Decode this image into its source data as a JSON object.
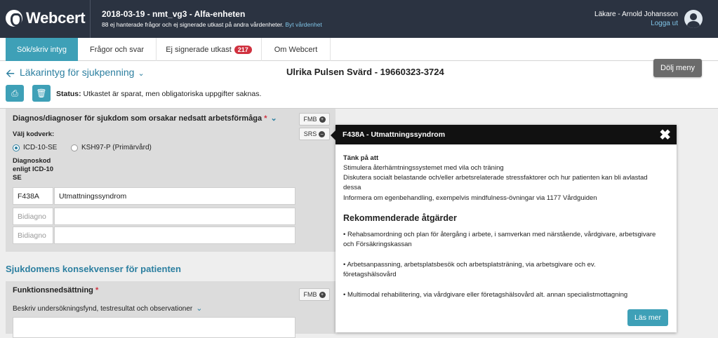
{
  "header": {
    "logo_text": "Webcert",
    "unit_title": "2018-03-19 - nmt_vg3 - Alfa-enheten",
    "unit_sub": "88 ej hanterade frågor och ej signerade utkast på andra vårdenheter.",
    "switch_unit": "Byt vårdenhet",
    "user": "Läkare - Arnold Johansson",
    "logout": "Logga ut"
  },
  "nav": {
    "tabs": [
      {
        "label": "Sök/skriv intyg"
      },
      {
        "label": "Frågor och svar"
      },
      {
        "label": "Ej signerade utkast",
        "badge": "217"
      },
      {
        "label": "Om Webcert"
      }
    ]
  },
  "page": {
    "cert_type": "Läkarintyg för sjukpenning",
    "patient": "Ulrika Pulsen Svärd - 19660323-3724",
    "hide_menu": "Dölj meny",
    "status_label": "Status:",
    "status_text": "Utkastet är sparat, men obligatoriska uppgifter saknas."
  },
  "form": {
    "diag_title": "Diagnos/diagnoser för sjukdom som orsakar nedsatt arbetsförmåga",
    "req_mark": "*",
    "fmb": "FMB",
    "srs": "SRS",
    "choose_code": "Välj kodverk:",
    "radio_1": "ICD-10-SE",
    "radio_2": "KSH97-P (Primärvård)",
    "code_label": "Diagnoskod enligt ICD-10 SE",
    "code": "F438A",
    "code_desc": "Utmattningssyndrom",
    "placeholder": "Bidiagno",
    "section_title": "Sjukdomens konsekvenser för patienten",
    "func_title": "Funktionsnedsättning",
    "func_sub": "Beskriv undersökningsfynd, testresultat och observationer"
  },
  "popup": {
    "title": "F438A - Utmattningssyndrom",
    "think_title": "Tänk på att",
    "think_lines": [
      "Stimulera återhämtningssystemet med vila och träning",
      "Diskutera socialt belastande och/eller arbetsrelaterade stressfaktorer och hur patienten kan bli avlastad dessa",
      "Informera om egenbehandling, exempelvis mindfulness-övningar via 1177 Vårdguiden"
    ],
    "rec_title": "Rekommenderade åtgärder",
    "rec_items": [
      "• Rehabsamordning och plan för återgång i arbete, i samverkan med närstående, vårdgivare, arbetsgivare och Försäkringskassan",
      "• Arbetsanpassning, arbetsplatsbesök och arbetsplatsträning, via arbetsgivare och ev. företagshälsovård",
      "• Multimodal rehabilitering, via vårdgivare eller företagshälsovård alt. annan specialistmottagning"
    ],
    "read_more": "Läs mer"
  },
  "colors": {
    "header_bg": "#2b3341",
    "accent": "#3ea0b7",
    "badge": "#d0313f",
    "link": "#2c7fa0"
  }
}
